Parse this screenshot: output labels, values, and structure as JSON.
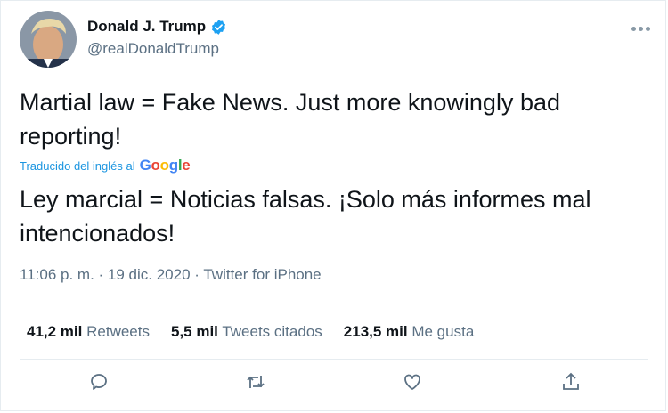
{
  "user": {
    "display_name": "Donald J. Trump",
    "handle": "@realDonaldTrump",
    "verified": true
  },
  "tweet": {
    "text": "Martial law = Fake News. Just more knowingly bad reporting!",
    "translated_label": "Traducido del inglés al",
    "translator": "Google",
    "translation": "Ley marcial = Noticias falsas. ¡Solo más informes mal intencionados!"
  },
  "meta": {
    "time": "11:06 p. m.",
    "separator": " · ",
    "date": "19 dic. 2020",
    "source": "Twitter for iPhone"
  },
  "stats": [
    {
      "value": "41,2 mil",
      "label": "Retweets"
    },
    {
      "value": "5,5 mil",
      "label": "Tweets citados"
    },
    {
      "value": "213,5 mil",
      "label": "Me gusta"
    }
  ],
  "colors": {
    "link": "#1b95e0",
    "verified": "#1da1f2",
    "secondary_text": "#5b7083"
  }
}
